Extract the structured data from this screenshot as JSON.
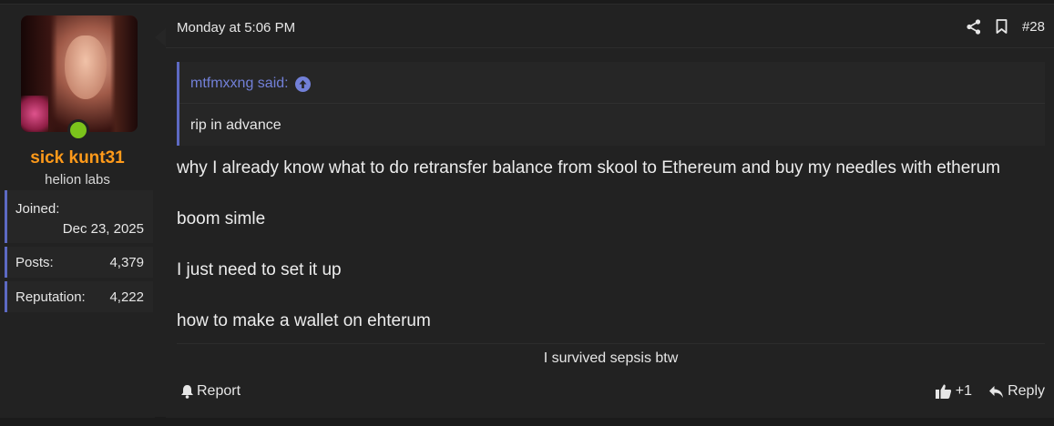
{
  "user": {
    "name": "sick kunt31",
    "title": "helion labs",
    "name_color": "#ff9a1a",
    "online_color": "#7bc31b",
    "stats": {
      "joined_label": "Joined:",
      "joined_value": "Dec 23, 2025",
      "posts_label": "Posts:",
      "posts_value": "4,379",
      "reputation_label": "Reputation:",
      "reputation_value": "4,222"
    }
  },
  "post": {
    "date": "Monday at 5:06 PM",
    "number": "#28",
    "icons": [
      "share-icon",
      "bookmark-icon"
    ],
    "quote": {
      "author": "mtfmxxng said:",
      "body": "rip in advance"
    },
    "lines": [
      "why I already know what to do retransfer balance from skool to Ethereum and buy my needles with etherum",
      "boom simle",
      "I just need to set it up",
      "how to make a wallet on ehterum"
    ],
    "signature": "I survived sepsis btw",
    "footer": {
      "report_label": "Report",
      "react_label": "+1",
      "reply_label": "Reply"
    }
  },
  "colors": {
    "accent": "#5d6ac3",
    "quote_author": "#7280d8"
  }
}
